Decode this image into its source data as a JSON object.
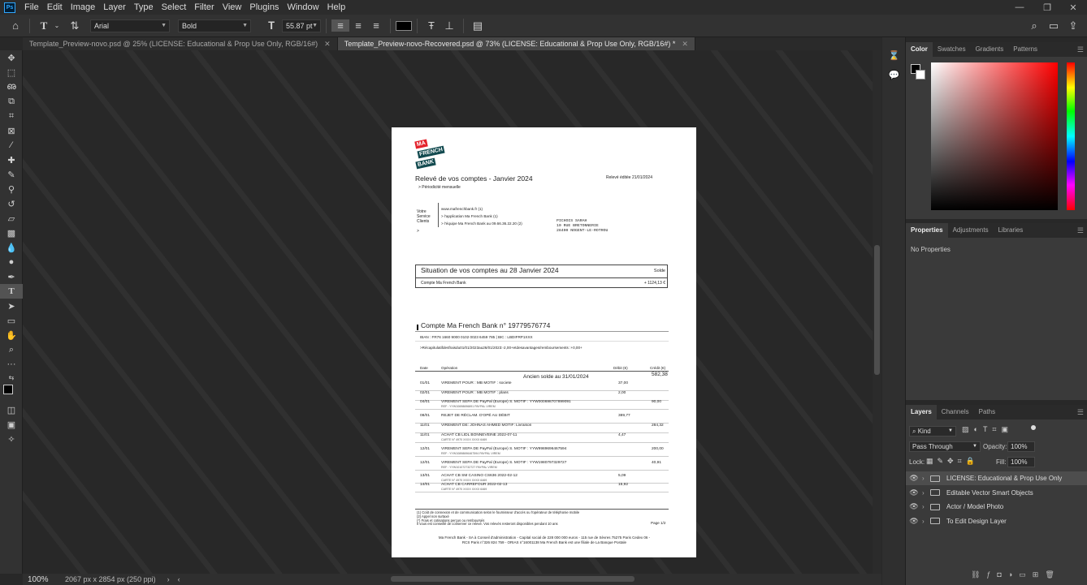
{
  "app": {
    "logo": "Ps",
    "menu": [
      "File",
      "Edit",
      "Image",
      "Layer",
      "Type",
      "Select",
      "Filter",
      "View",
      "Plugins",
      "Window",
      "Help"
    ]
  },
  "options": {
    "font_family": "Arial",
    "font_style": "Bold",
    "font_size": "55.87 pt",
    "text_color": "#000000"
  },
  "tabs": [
    {
      "label": "Template_Preview-novo.psd @ 25% (LICENSE: Educational & Prop Use Only, RGB/16#)",
      "active": false
    },
    {
      "label": "Template_Preview-novo-Recovered.psd @ 73% (LICENSE: Educational & Prop Use Only, RGB/16#) *",
      "active": true
    }
  ],
  "status": {
    "zoom": "100%",
    "doc_size": "2067 px x 2854 px (250 ppi)"
  },
  "document": {
    "logo_lines": [
      "MA",
      "FRENCH",
      "BANK"
    ],
    "title": "Relevé de vos comptes - Janvier 2024",
    "edit_date": "Relevé éditée 21/01/2024",
    "periodicity": "> Périodicité mensuelle",
    "service_label": [
      "Votre",
      "Service",
      "Clients"
    ],
    "service_arrow": ">",
    "service_lines": [
      "www.mafrenchbank.fr (1)",
      "> l'application Ma French Bank (1)",
      "> l'équipe Ma French Bank au 09.66.36.22.20 (2)"
    ],
    "address": [
      "PICHOIS SARAH",
      "10 RUE BRETONNERIE",
      "28400 NOGENT-LE-ROTROU"
    ],
    "situation_title": "Situation de vos comptes au 28 Janvier 2024",
    "solde_label": "Solde",
    "account_line": "Compte Ma French Bank",
    "account_balance": "+ 1124,13 €",
    "account_title": "Compte Ma French Bank n° 19779576774",
    "iban": "IBAN : FR76 1660 9000 0102 0023 6459 785 | BIC : LBDIFRP1XXX",
    "recap": ">Récapitulatifdesfraisdu01/01/2023au26/01/2023:-2,00+etdesavantages/remboursements :+0,00+",
    "col_date": "Date",
    "col_operation": "Opération",
    "col_debit": "Débit (€)",
    "col_credit": "Crédit (€)",
    "ancien_solde": "Ancien solde au 31/01/2024",
    "ancien_value": "582,38",
    "transactions": [
      {
        "date": "01/01",
        "op": "VIREMENT POUR : MB MOTIF : societe",
        "sub": "",
        "debit": "37,00",
        "credit": ""
      },
      {
        "date": "02/01",
        "op": "VIREMENT POUR : MB MOTIF : plans",
        "sub": "",
        "debit": "2,00",
        "credit": ""
      },
      {
        "date": "04/01",
        "op": "VIREMENT SEPA DE PayPal (Europe) S. MOTIF : YYW000698707899091",
        "sub": "REF : YYW10698696891 PAYPAL VIREM",
        "debit": "",
        "credit": "90,00"
      },
      {
        "date": "08/01",
        "op": "REJET DE RÉCLAM. D'OPÉ AU DÉBIT",
        "sub": "",
        "debit": "389,77",
        "credit": ""
      },
      {
        "date": "11/01",
        "op": "VIREMENT DE: JOHNAS AHMED MOTIF: Livraison",
        "sub": "",
        "debit": "",
        "credit": "284,32"
      },
      {
        "date": "11/01",
        "op": "ACHAT CB LIDL BONNEVEINE 2022-07-11",
        "sub": "CARTE N° 4970 XXXX XXXX 6469",
        "debit": "4,47",
        "credit": ""
      },
      {
        "date": "12/01",
        "op": "VIREMENT SEPA DE PayPal (Europe) S. MOTIF : YYW9989696467594",
        "sub": "REF : YYW10898696467594 PAYPAL VIREM",
        "debit": "",
        "credit": "200,00"
      },
      {
        "date": "12/01",
        "op": "VIREMENT SEPA DE PayPal (Europe) S. MOTIF : YYW1980797329727",
        "sub": "REF : YYW101072732727 PAYPAL VIREM",
        "debit": "",
        "credit": "40,91"
      },
      {
        "date": "13/01",
        "op": "ACHAT CB SM CASINO CS636 2022-02-12",
        "sub": "CARTE N° 4970 XXXX XXXX 6469",
        "debit": "5,09",
        "credit": ""
      },
      {
        "date": "14/01",
        "op": "ACHAT CB CARREFOUR 2022-02-13",
        "sub": "CARTE N° 4970 XXXX XXXX 6469",
        "debit": "15,92",
        "credit": ""
      }
    ],
    "footnotes": [
      "(1) Coût de connexion et de communication selon le fournisseur d'accès ou l'opérateur de téléphonie mobile",
      "(2) Appel non surtaxé",
      "(*) Frais et cotisations perçus ou remboursés",
      "Il vous est conseillé de conserver ce relevé. Vos relevés resteront disponibles pendant 10 ans"
    ],
    "page": "Page 1/2",
    "legal": [
      "Ma French Bank - SA à Conseil d'administration - Capital social de 228 000 000 euros - 115 rue de Sèvres 75275 Paris Cedex 06 -",
      "RCS Paris n°326 824 759 - ORIAS n°16001138 Ma French Bank est une filiale de La Banque Postale"
    ]
  },
  "panels": {
    "color_tabs": [
      "Color",
      "Swatches",
      "Gradients",
      "Patterns"
    ],
    "props_tabs": [
      "Properties",
      "Adjustments",
      "Libraries"
    ],
    "no_properties": "No Properties",
    "layers_tabs": [
      "Layers",
      "Channels",
      "Paths"
    ],
    "kind_label": "Kind",
    "blend_mode": "Pass Through",
    "opacity_label": "Opacity:",
    "opacity_value": "100%",
    "lock_label": "Lock:",
    "fill_label": "Fill:",
    "fill_value": "100%",
    "layers": [
      {
        "name": "LICENSE: Educational & Prop Use Only",
        "selected": true
      },
      {
        "name": "Editable Vector Smart Objects",
        "selected": false
      },
      {
        "name": "Actor / Model Photo",
        "selected": false
      },
      {
        "name": "To Edit Design Layer",
        "selected": false
      }
    ]
  }
}
